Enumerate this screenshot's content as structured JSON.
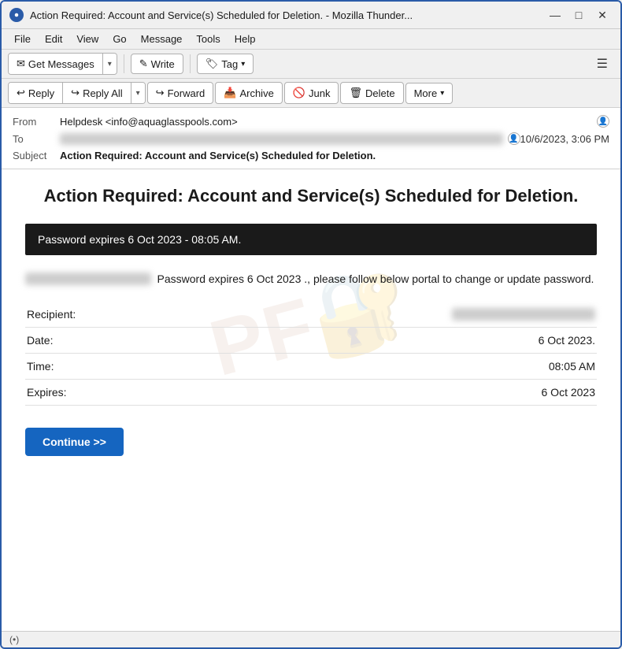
{
  "window": {
    "title": "Action Required: Account and Service(s) Scheduled for Deletion. - Mozilla Thunder...",
    "icon": "thunderbird-icon"
  },
  "menu": {
    "items": [
      "File",
      "Edit",
      "View",
      "Go",
      "Message",
      "Tools",
      "Help"
    ]
  },
  "toolbar": {
    "get_messages_label": "Get Messages",
    "write_label": "Write",
    "tag_label": "Tag"
  },
  "action_toolbar": {
    "reply_label": "Reply",
    "reply_all_label": "Reply All",
    "forward_label": "Forward",
    "archive_label": "Archive",
    "junk_label": "Junk",
    "delete_label": "Delete",
    "more_label": "More"
  },
  "email_header": {
    "from_label": "From",
    "from_value": "Helpdesk <info@aquaglasspools.com>",
    "to_label": "To",
    "to_value": "████████████",
    "date_value": "10/6/2023, 3:06 PM",
    "subject_label": "Subject",
    "subject_value": "Action Required: Account and Service(s) Scheduled for Deletion."
  },
  "email_body": {
    "title": "Action Required: Account and Service(s) Scheduled for Deletion.",
    "password_banner": "Password expires  6 Oct 2023 - 08:05 AM.",
    "paragraph": "Password expires 6 Oct 2023 ., please follow below portal to change or update password.",
    "recipient_label": "Recipient:",
    "recipient_value": "████████████████████████",
    "date_label": "Date:",
    "date_value": "6 Oct 2023.",
    "time_label": "Time:",
    "time_value": "08:05 AM",
    "expires_label": "Expires:",
    "expires_value": "6 Oct 2023",
    "continue_btn": "Continue >>"
  },
  "status_bar": {
    "signal_label": "(•)"
  }
}
